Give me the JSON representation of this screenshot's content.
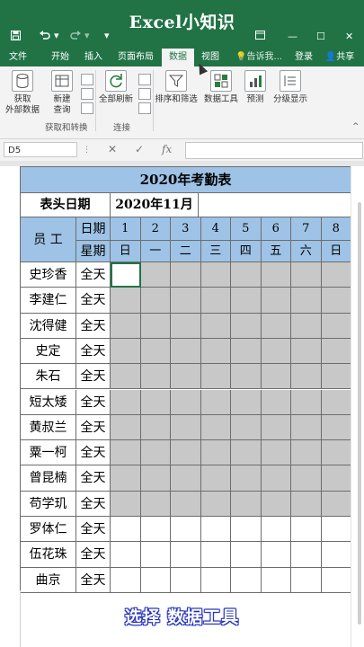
{
  "app": {
    "title": "Excel小知识"
  },
  "qat": {
    "save_icon": "save-icon",
    "undo_icon": "undo-icon",
    "redo_icon": "redo-icon",
    "more": "▾"
  },
  "window": {
    "restore_icon": "ribbon-display-icon",
    "minimize": "—",
    "maximize": "☐",
    "close": "✕"
  },
  "tabs": [
    "文件",
    "开始",
    "插入",
    "页面布局",
    "数据",
    "视图"
  ],
  "active_tab": "数据",
  "tell_me": "告诉我...",
  "login": "登录",
  "share": "共享",
  "ribbon": {
    "get_external": {
      "line1": "获取",
      "line2": "外部数据"
    },
    "new_query": {
      "line1": "新建",
      "line2": "查询"
    },
    "group_get": "获取和转换",
    "refresh_all": "全部刷新",
    "group_connect": "连接",
    "sort_filter": "排序和筛选",
    "data_tools": "数据工具",
    "forecast": "预测",
    "outline": "分级显示"
  },
  "formula_bar": {
    "name_box": "D5",
    "cancel": "✕",
    "enter": "✓",
    "fx": "fx",
    "value": ""
  },
  "sheet": {
    "title": "2020年考勤表",
    "header_date_label": "表头日期",
    "header_date_value": "2020年11月",
    "employee_label": "员  工",
    "date_label": "日期",
    "weekday_label": "星期",
    "days": [
      "1",
      "2",
      "3",
      "4",
      "5",
      "6",
      "7",
      "8"
    ],
    "weekdays": [
      "日",
      "一",
      "二",
      "三",
      "四",
      "五",
      "六",
      "日"
    ],
    "employees": [
      {
        "name": "史珍香",
        "shift": "全天"
      },
      {
        "name": "李建仁",
        "shift": "全天"
      },
      {
        "name": "沈得健",
        "shift": "全天"
      },
      {
        "name": "史定",
        "shift": "全天"
      },
      {
        "name": "朱石",
        "shift": "全天"
      },
      {
        "name": "短太矮",
        "shift": "全天"
      },
      {
        "name": "黄叔兰",
        "shift": "全天"
      },
      {
        "name": "粟一柯",
        "shift": "全天"
      },
      {
        "name": "曾昆楠",
        "shift": "全天"
      },
      {
        "name": "苟学玑",
        "shift": "全天"
      },
      {
        "name": "罗体仁",
        "shift": "全天"
      },
      {
        "name": "伍花珠",
        "shift": "全天"
      },
      {
        "name": "曲京",
        "shift": "全天"
      }
    ],
    "selected_rows": [
      1,
      2,
      3,
      4,
      5,
      6,
      7,
      8,
      9
    ]
  },
  "caption": "选择 数据工具",
  "colors": {
    "excel_green": "#217346",
    "header_blue": "#9ec3e6",
    "selection_gray": "#c8c8c8"
  }
}
